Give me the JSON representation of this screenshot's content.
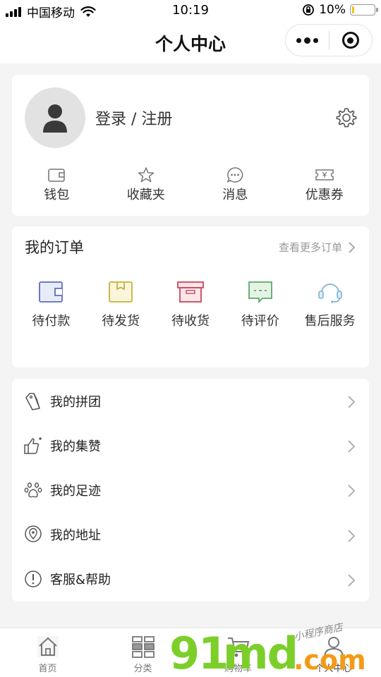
{
  "status_bar": {
    "carrier": "中国移动",
    "time": "10:19",
    "battery_percent": "10%",
    "battery_level": 0.1
  },
  "nav": {
    "title": "个人中心"
  },
  "profile": {
    "login_text": "登录 / 注册",
    "quick_links": [
      {
        "label": "钱包",
        "icon": "wallet-icon"
      },
      {
        "label": "收藏夹",
        "icon": "star-icon"
      },
      {
        "label": "消息",
        "icon": "message-icon"
      },
      {
        "label": "优惠券",
        "icon": "coupon-icon"
      }
    ]
  },
  "orders": {
    "title": "我的订单",
    "more_link": "查看更多订单",
    "items": [
      {
        "label": "待付款",
        "icon": "wallet-icon",
        "color": "#5b6cc0"
      },
      {
        "label": "待发货",
        "icon": "package-icon",
        "color": "#c5b23b"
      },
      {
        "label": "待收货",
        "icon": "box-icon",
        "color": "#c9485b"
      },
      {
        "label": "待评价",
        "icon": "comment-icon",
        "color": "#5fa868"
      },
      {
        "label": "售后服务",
        "icon": "headset-icon",
        "color": "#7fb1d6"
      }
    ]
  },
  "menu": {
    "items": [
      {
        "label": "我的拼团",
        "icon": "tag-icon"
      },
      {
        "label": "我的集赞",
        "icon": "thumbs-up-icon"
      },
      {
        "label": "我的足迹",
        "icon": "paw-icon"
      },
      {
        "label": "我的地址",
        "icon": "location-icon"
      },
      {
        "label": "客服&帮助",
        "icon": "help-icon"
      }
    ]
  },
  "tabbar": {
    "tabs": [
      {
        "label": "首页",
        "icon": "home-icon"
      },
      {
        "label": "分类",
        "icon": "grid-icon"
      },
      {
        "label": "购物车",
        "icon": "cart-icon"
      },
      {
        "label": "个人中心",
        "icon": "user-icon"
      }
    ],
    "active_index": 3
  },
  "watermark": {
    "brand_number": "91",
    "brand_letters": "md",
    "domain_suffix": ".com",
    "tagline": "小程序商店"
  },
  "colors": {
    "accent_green": "#7ccf2a",
    "accent_orange": "#f39b16"
  }
}
